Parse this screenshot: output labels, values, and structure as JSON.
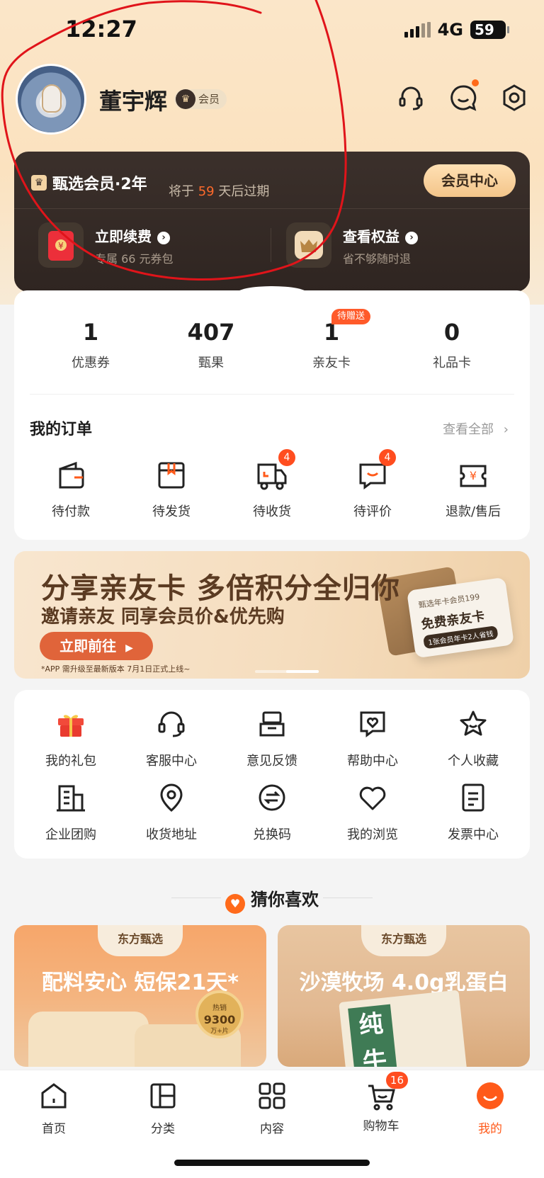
{
  "status_bar": {
    "time": "12:27",
    "network": "4G",
    "battery": "59"
  },
  "profile": {
    "name": "董宇辉",
    "vip_tag": "会员"
  },
  "membership": {
    "title": "甄选会员·2年",
    "expire_prefix": "将于",
    "expire_days": "59",
    "expire_suffix": "天后过期",
    "center_button": "会员中心",
    "renew_title": "立即续费",
    "renew_sub": "专属 66 元券包",
    "benefits_title": "查看权益",
    "benefits_sub": "省不够随时退"
  },
  "stats": [
    {
      "value": "1",
      "label": "优惠券"
    },
    {
      "value": "407",
      "label": "甄果"
    },
    {
      "value": "1",
      "label": "亲友卡",
      "tag": "待赠送"
    },
    {
      "value": "0",
      "label": "礼品卡"
    }
  ],
  "orders": {
    "title": "我的订单",
    "view_all": "查看全部",
    "items": [
      {
        "label": "待付款",
        "icon": "wallet-icon"
      },
      {
        "label": "待发货",
        "icon": "package-icon"
      },
      {
        "label": "待收货",
        "icon": "delivery-truck-icon",
        "badge": "4"
      },
      {
        "label": "待评价",
        "icon": "review-chat-icon",
        "badge": "4"
      },
      {
        "label": "退款/售后",
        "icon": "refund-icon"
      }
    ]
  },
  "banner": {
    "headline": "分享亲友卡 多倍积分全归你",
    "subline": "邀请亲友 同享会员价&优先购",
    "button": "立即前往",
    "note": "*APP 需升级至最新版本   7月1日正式上线~",
    "card_line1": "甄选年卡会员199",
    "card_line2": "免费亲友卡",
    "card_line3": "1张会员年卡2人省钱"
  },
  "services": [
    {
      "label": "我的礼包",
      "icon": "gift-icon"
    },
    {
      "label": "客服中心",
      "icon": "headset-icon"
    },
    {
      "label": "意见反馈",
      "icon": "feedback-icon"
    },
    {
      "label": "帮助中心",
      "icon": "help-heart-icon"
    },
    {
      "label": "个人收藏",
      "icon": "star-icon"
    },
    {
      "label": "企业团购",
      "icon": "building-icon"
    },
    {
      "label": "收货地址",
      "icon": "location-pin-icon"
    },
    {
      "label": "兑换码",
      "icon": "exchange-icon"
    },
    {
      "label": "我的浏览",
      "icon": "heart-icon"
    },
    {
      "label": "发票中心",
      "icon": "invoice-icon"
    }
  ],
  "recommend": {
    "title": "猜你喜欢",
    "products": [
      {
        "brand": "东方甄选",
        "headline": "配料安心 短保21天*",
        "seal_top": "热销",
        "seal_main": "9300",
        "seal_sub": "万+片"
      },
      {
        "brand": "东方甄选",
        "headline": "沙漠牧场 4.0g乳蛋白",
        "pack_text": "纯牛"
      }
    ]
  },
  "tabbar": [
    {
      "label": "首页",
      "icon": "home-icon"
    },
    {
      "label": "分类",
      "icon": "category-icon"
    },
    {
      "label": "内容",
      "icon": "content-grid-icon"
    },
    {
      "label": "购物车",
      "icon": "cart-icon",
      "badge": "16"
    },
    {
      "label": "我的",
      "icon": "profile-smile-icon",
      "active": true
    }
  ],
  "colors": {
    "accent": "#ff5a1a",
    "badge": "#ff4d1f",
    "member_card": "#2f2521",
    "gold": "#f3c58a"
  }
}
